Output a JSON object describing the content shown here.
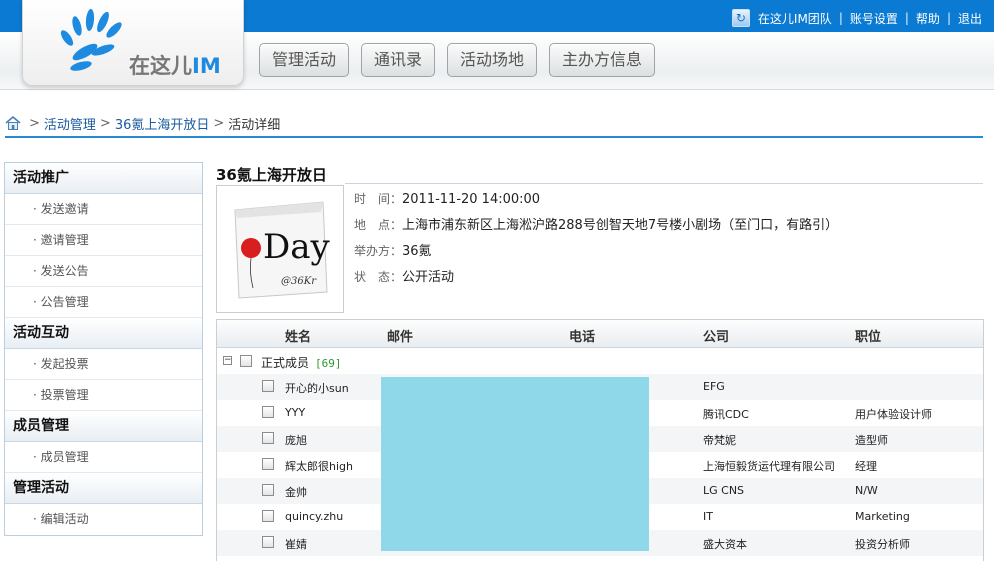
{
  "top_links": {
    "team": "在这儿IM团队",
    "account": "账号设置",
    "help": "帮助",
    "logout": "退出",
    "separator": "|"
  },
  "logo": {
    "prefix": "在这儿",
    "suffix": "IM"
  },
  "main_nav": [
    "管理活动",
    "通讯录",
    "活动场地",
    "主办方信息"
  ],
  "breadcrumb": {
    "items": [
      "活动管理",
      "36氪上海开放日",
      "活动详细"
    ],
    "sep": ">"
  },
  "sidebar": {
    "sections": [
      {
        "title": "活动推广",
        "items": [
          "· 发送邀请",
          "· 邀请管理",
          "· 发送公告",
          "· 公告管理"
        ]
      },
      {
        "title": "活动互动",
        "items": [
          "· 发起投票",
          "· 投票管理"
        ]
      },
      {
        "title": "成员管理",
        "items": [
          "· 成员管理"
        ]
      },
      {
        "title": "管理活动",
        "items": [
          "· 编辑活动"
        ]
      }
    ]
  },
  "event": {
    "title": "36氪上海开放日",
    "poster_text": "Day",
    "poster_sub": "@36Kr",
    "time_label": "时　间：",
    "time": "2011-11-20 14:00:00",
    "place_label": "地　点：",
    "place": "上海市浦东新区上海淞沪路288号创智天地7号楼小剧场（至门口，有路引）",
    "host_label": "举办方：",
    "host": "36氪",
    "status_label": "状　态：",
    "status": "公开活动"
  },
  "table": {
    "headers": {
      "name": "姓名",
      "email": "邮件",
      "phone": "电话",
      "company": "公司",
      "title": "职位"
    },
    "group": {
      "label": "正式成员",
      "count": "[69]"
    },
    "rows": [
      {
        "name": "开心的小sun",
        "company": "EFG",
        "title": ""
      },
      {
        "name": "YYY",
        "company": "腾讯CDC",
        "title": "用户体验设计师"
      },
      {
        "name": "庞旭",
        "company": "帝梵妮",
        "title": "造型师"
      },
      {
        "name": "辉太郎很high",
        "company": "上海恒毅货运代理有限公司",
        "title": "经理"
      },
      {
        "name": "金帅",
        "company": "LG CNS",
        "title": "N/W"
      },
      {
        "name": "quincy.zhu",
        "company": "IT",
        "title": "Marketing"
      },
      {
        "name": "崔婧",
        "company": "盛大资本",
        "title": "投资分析师"
      }
    ]
  },
  "colors": {
    "top_band": "#0a7ad3",
    "accent": "#2a8ad1",
    "redacted": "#8fd8ea",
    "count_green": "#2a9a2a"
  }
}
